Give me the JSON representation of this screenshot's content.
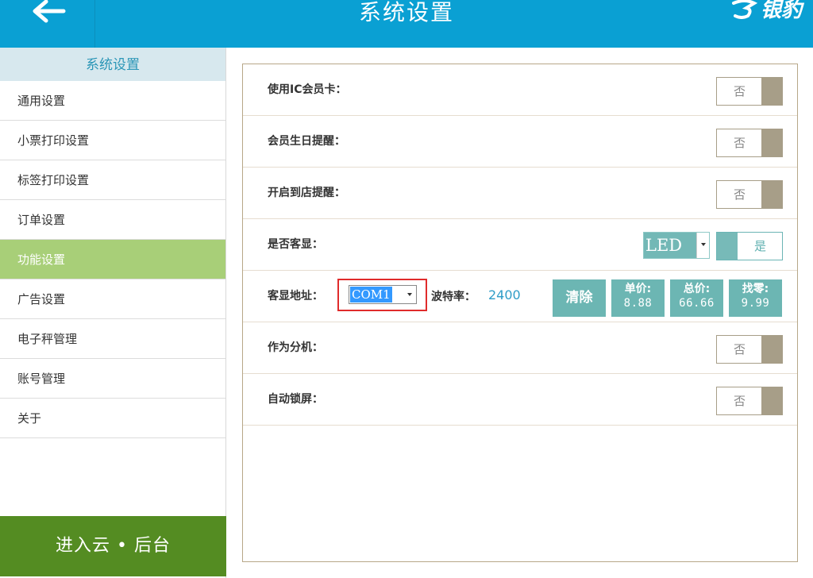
{
  "header": {
    "title": "系统设置",
    "brand": "银豹",
    "back_icon": "arrow-left-icon"
  },
  "sidebar": {
    "heading": "系统设置",
    "items": [
      {
        "label": "通用设置",
        "active": false
      },
      {
        "label": "小票打印设置",
        "active": false
      },
      {
        "label": "标签打印设置",
        "active": false
      },
      {
        "label": "订单设置",
        "active": false
      },
      {
        "label": "功能设置",
        "active": true
      },
      {
        "label": "广告设置",
        "active": false
      },
      {
        "label": "电子秤管理",
        "active": false
      },
      {
        "label": "账号管理",
        "active": false
      },
      {
        "label": "关于",
        "active": false
      }
    ],
    "cloud_button": "进入云 • 后台"
  },
  "settings": {
    "ic_card": {
      "label": "使用IC会员卡：",
      "value": "否"
    },
    "birthday": {
      "label": "会员生日提醒：",
      "value": "否"
    },
    "arrival": {
      "label": "开启到店提醒：",
      "value": "否"
    },
    "customer_display": {
      "label": "是否客显：",
      "type": "LED",
      "value": "是"
    },
    "display_address": {
      "label": "客显地址：",
      "port": "COM1",
      "baud_label": "波特率：",
      "baud_value": "2400",
      "clear_button": "清除",
      "unit_price": {
        "label": "单价:",
        "value": "8.88"
      },
      "total": {
        "label": "总价:",
        "value": "66.66"
      },
      "change": {
        "label": "找零:",
        "value": "9.99"
      }
    },
    "sub_terminal": {
      "label": "作为分机：",
      "value": "否"
    },
    "auto_lock": {
      "label": "自动锁屏：",
      "value": "否"
    }
  },
  "colors": {
    "header": "#0aa0d3",
    "active_item": "#a8cf78",
    "cloud_button": "#548c22",
    "teal": "#6cb6b3",
    "toggle_off": "#a79e88"
  }
}
